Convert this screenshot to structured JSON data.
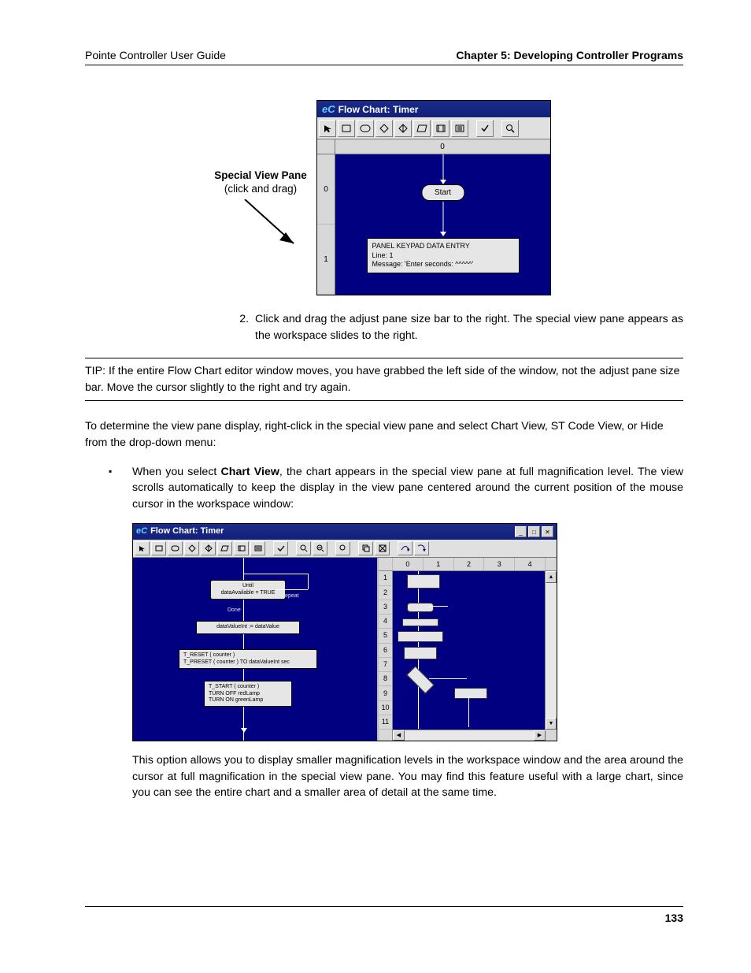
{
  "header": {
    "left": "Pointe Controller User Guide",
    "right": "Chapter 5: Developing Controller Programs"
  },
  "callout": {
    "title": "Special View Pane",
    "sub": "(click and drag)"
  },
  "fig1": {
    "title": "Flow Chart: Timer",
    "ruler_top": [
      "0"
    ],
    "ruler_side": [
      "0",
      "1"
    ],
    "start_label": "Start",
    "box_lines": [
      "PANEL KEYPAD DATA ENTRY",
      "Line: 1",
      "Message: 'Enter seconds: ^^^^^'"
    ]
  },
  "step2": "Click and drag the adjust pane size bar to the right. The special view pane appears as the workspace slides to the right.",
  "tip": "TIP: If the entire Flow Chart editor window moves, you have grabbed the left side of the window, not the adjust pane size bar. Move the cursor slightly to the right and try again.",
  "para1": "To determine the view pane display, right-click in the special view pane and select Chart View, ST Code View, or Hide from the drop-down menu:",
  "bullet1_pre": "When you select ",
  "bullet1_bold": "Chart View",
  "bullet1_post": ", the chart appears in the special view pane at full magnification level. The view scrolls automatically to keep the display in the view pane centered around the current position of the mouse cursor in the workspace window:",
  "fig2": {
    "title": "Flow Chart: Timer",
    "hruler": [
      "",
      "0",
      "1",
      "2",
      "3",
      "4"
    ],
    "vruler": [
      "1",
      "2",
      "3",
      "4",
      "5",
      "6",
      "7",
      "8",
      "9",
      "10",
      "11"
    ],
    "blocks": {
      "until": "Until\ndataAvailable = TRUE",
      "repeat": "Repeat",
      "done": "Done",
      "assign": "dataValueInt := dataValue",
      "reset": "T_RESET ( counter )\nT_PRESET ( counter ) TO dataValueInt sec",
      "start": "T_START ( counter )\nTURN OFF redLamp\nTURN ON greenLamp"
    }
  },
  "para2": "This option allows you to display smaller magnification levels in the workspace window and the area around the cursor at full magnification in the special view pane. You may find this feature useful with a large chart, since you can see the entire chart and a smaller area of detail at the same time.",
  "page_number": "133",
  "icons": {
    "pointer": "pointer",
    "rect": "action-block",
    "roundrect": "start-stop",
    "diamond": "decision",
    "diamond2": "if-then",
    "parallelo": "io-block",
    "doc": "subroutine",
    "list": "structured-text",
    "check": "syntax-check",
    "zoomin": "zoom-in",
    "zoomout": "zoom-out",
    "find": "find",
    "copy": "copy",
    "fit": "fit",
    "over": "step-over",
    "into": "step-into"
  }
}
